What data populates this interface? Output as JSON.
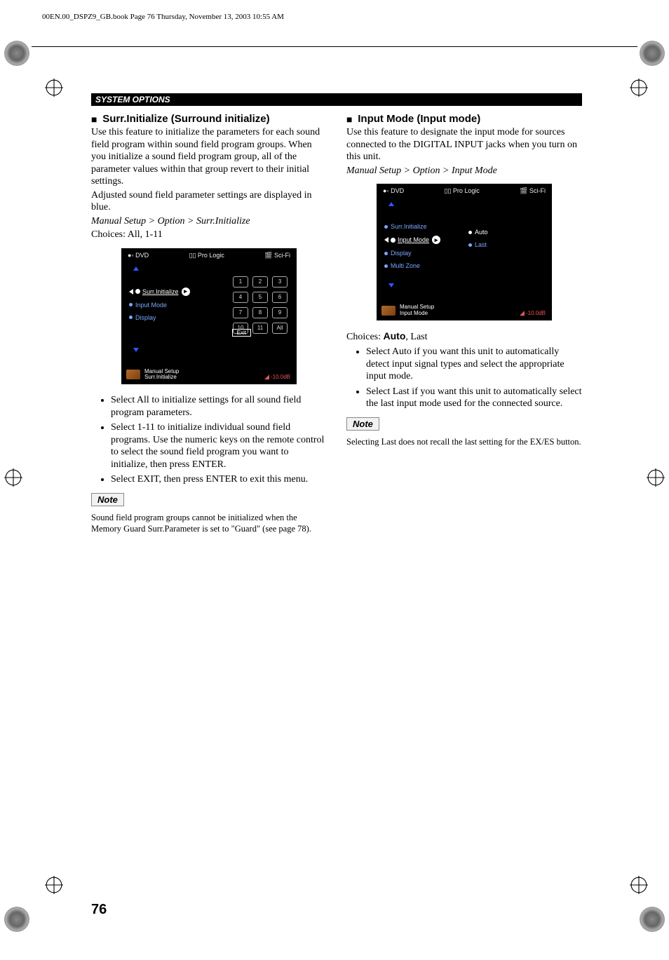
{
  "header": "00EN.00_DSPZ9_GB.book  Page 76  Thursday, November 13, 2003  10:55 AM",
  "section_bar": "SYSTEM OPTIONS",
  "page_number": "76",
  "left": {
    "heading": "Surr.Initialize (Surround initialize)",
    "p1": "Use this feature to initialize the parameters for each sound field program within sound field program groups. When you initialize a sound field program group, all of the parameter values within that group revert to their initial settings.",
    "p2": "Adjusted sound field parameter settings are displayed in blue.",
    "breadcrumb": "Manual Setup > Option > Surr.Initialize",
    "choices": "Choices: All, 1-11",
    "bullets": [
      "Select All to initialize settings for all sound field program parameters.",
      "Select 1-11 to initialize individual sound field programs. Use the numeric keys on the remote control to select the sound field program you want to initialize, then press ENTER.",
      "Select EXIT, then press ENTER to exit this menu."
    ],
    "note_label": "Note",
    "note_text": "Sound field program groups cannot be initialized when the Memory Guard Surr.Parameter is set to \"Guard\" (see page 78).",
    "osd": {
      "top_left": "DVD",
      "top_mid": "Pro Logic",
      "top_right": "Sci-Fi",
      "menu": [
        "Surr.Initialize",
        "Input Mode",
        "Display"
      ],
      "menu_selected_index": 0,
      "keys": [
        "1",
        "2",
        "3",
        "4",
        "5",
        "6",
        "7",
        "8",
        "9",
        "10",
        "11",
        "All"
      ],
      "exit": "Exit",
      "footer_line1": "Manual Setup",
      "footer_line2": "Surr.Initialize",
      "db": "-10.0dB"
    }
  },
  "right": {
    "heading": "Input Mode (Input mode)",
    "p1": "Use this feature to designate the input mode for sources connected to the DIGITAL INPUT jacks when you turn on this unit.",
    "breadcrumb": "Manual Setup > Option > Input Mode",
    "choices_prefix": "Choices: ",
    "choices_bold": "Auto",
    "choices_rest": ", Last",
    "bullets": [
      "Select Auto if you want this unit to automatically detect input signal types and select the appropriate input mode.",
      "Select Last if you want this unit to automatically select the last input mode used for the connected source."
    ],
    "note_label": "Note",
    "note_text": "Selecting Last does not recall the last setting for the EX/ES button.",
    "osd": {
      "top_left": "DVD",
      "top_mid": "Pro Logic",
      "top_right": "Sci-Fi",
      "menu": [
        "Surr.Initialize",
        "Input Mode",
        "Display",
        "Multi Zone"
      ],
      "menu_selected_index": 1,
      "options": [
        "Auto",
        "Last"
      ],
      "options_selected_index": 0,
      "footer_line1": "Manual Setup",
      "footer_line2": "Input Mode",
      "db": "-10.0dB"
    }
  }
}
